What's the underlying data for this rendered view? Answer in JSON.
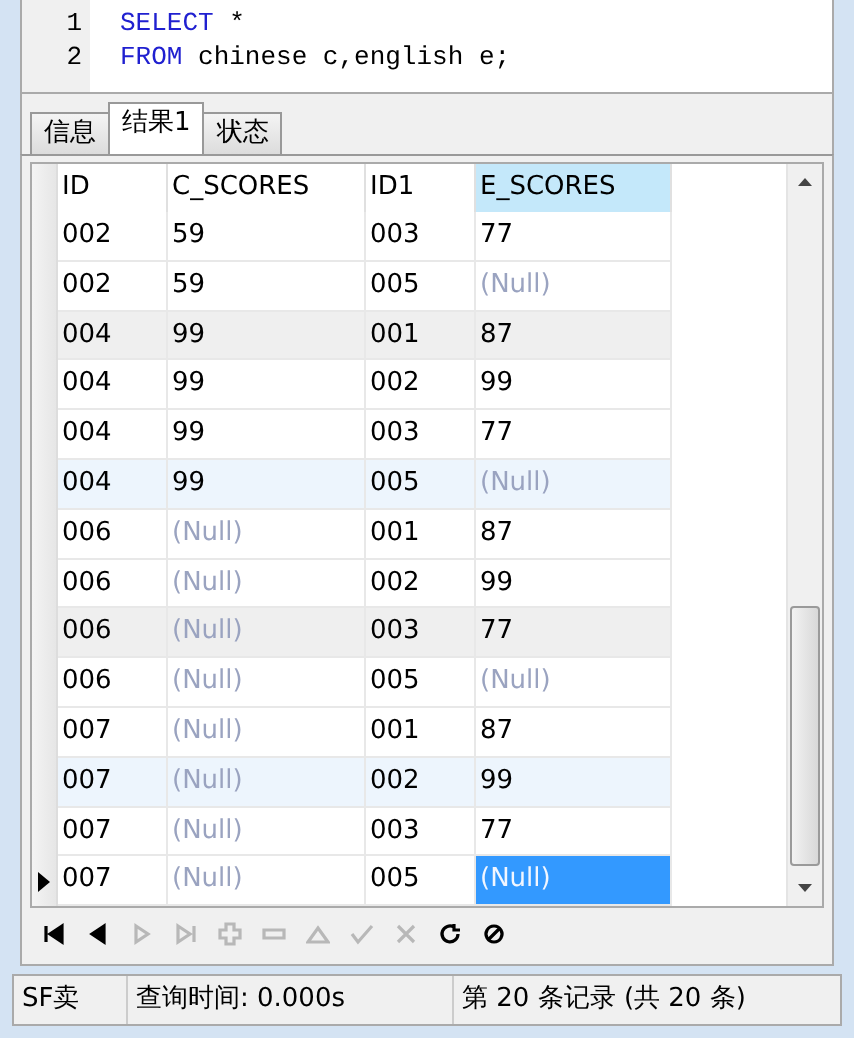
{
  "editor": {
    "lines": [
      {
        "number": "1",
        "tokens": [
          {
            "text": "SELECT",
            "kind": "keyword"
          },
          {
            "text": " *",
            "kind": "plain"
          }
        ]
      },
      {
        "number": "2",
        "tokens": [
          {
            "text": "FROM",
            "kind": "keyword"
          },
          {
            "text": " chinese c,english e;",
            "kind": "plain"
          }
        ]
      }
    ]
  },
  "tabs": [
    {
      "label": "信息",
      "selected": false
    },
    {
      "label": "结果1",
      "selected": true
    },
    {
      "label": "状态",
      "selected": false
    }
  ],
  "table": {
    "columns": [
      {
        "label": "ID",
        "selected": false
      },
      {
        "label": "C_SCORES",
        "selected": false
      },
      {
        "label": "ID1",
        "selected": false
      },
      {
        "label": "E_SCORES",
        "selected": true
      }
    ],
    "rows": [
      {
        "kind": "plain",
        "selected": false,
        "cells": [
          {
            "text": "002",
            "null": false,
            "selected": false
          },
          {
            "text": "59",
            "null": false,
            "selected": false
          },
          {
            "text": "003",
            "null": false,
            "selected": false
          },
          {
            "text": "77",
            "null": false,
            "selected": false
          }
        ]
      },
      {
        "kind": "plain",
        "selected": false,
        "cells": [
          {
            "text": "002",
            "null": false,
            "selected": false
          },
          {
            "text": "59",
            "null": false,
            "selected": false
          },
          {
            "text": "005",
            "null": false,
            "selected": false
          },
          {
            "text": "(Null)",
            "null": true,
            "selected": false
          }
        ]
      },
      {
        "kind": "shaded",
        "selected": false,
        "cells": [
          {
            "text": "004",
            "null": false,
            "selected": false
          },
          {
            "text": "99",
            "null": false,
            "selected": false
          },
          {
            "text": "001",
            "null": false,
            "selected": false
          },
          {
            "text": "87",
            "null": false,
            "selected": false
          }
        ]
      },
      {
        "kind": "plain",
        "selected": false,
        "cells": [
          {
            "text": "004",
            "null": false,
            "selected": false
          },
          {
            "text": "99",
            "null": false,
            "selected": false
          },
          {
            "text": "002",
            "null": false,
            "selected": false
          },
          {
            "text": "99",
            "null": false,
            "selected": false
          }
        ]
      },
      {
        "kind": "plain",
        "selected": false,
        "cells": [
          {
            "text": "004",
            "null": false,
            "selected": false
          },
          {
            "text": "99",
            "null": false,
            "selected": false
          },
          {
            "text": "003",
            "null": false,
            "selected": false
          },
          {
            "text": "77",
            "null": false,
            "selected": false
          }
        ]
      },
      {
        "kind": "highlighted",
        "selected": false,
        "cells": [
          {
            "text": "004",
            "null": false,
            "selected": false
          },
          {
            "text": "99",
            "null": false,
            "selected": false
          },
          {
            "text": "005",
            "null": false,
            "selected": false
          },
          {
            "text": "(Null)",
            "null": true,
            "selected": false
          }
        ]
      },
      {
        "kind": "plain",
        "selected": false,
        "cells": [
          {
            "text": "006",
            "null": false,
            "selected": false
          },
          {
            "text": "(Null)",
            "null": true,
            "selected": false
          },
          {
            "text": "001",
            "null": false,
            "selected": false
          },
          {
            "text": "87",
            "null": false,
            "selected": false
          }
        ]
      },
      {
        "kind": "plain",
        "selected": false,
        "cells": [
          {
            "text": "006",
            "null": false,
            "selected": false
          },
          {
            "text": "(Null)",
            "null": true,
            "selected": false
          },
          {
            "text": "002",
            "null": false,
            "selected": false
          },
          {
            "text": "99",
            "null": false,
            "selected": false
          }
        ]
      },
      {
        "kind": "shaded",
        "selected": false,
        "cells": [
          {
            "text": "006",
            "null": false,
            "selected": false
          },
          {
            "text": "(Null)",
            "null": true,
            "selected": false
          },
          {
            "text": "003",
            "null": false,
            "selected": false
          },
          {
            "text": "77",
            "null": false,
            "selected": false
          }
        ]
      },
      {
        "kind": "plain",
        "selected": false,
        "cells": [
          {
            "text": "006",
            "null": false,
            "selected": false
          },
          {
            "text": "(Null)",
            "null": true,
            "selected": false
          },
          {
            "text": "005",
            "null": false,
            "selected": false
          },
          {
            "text": "(Null)",
            "null": true,
            "selected": false
          }
        ]
      },
      {
        "kind": "plain",
        "selected": false,
        "cells": [
          {
            "text": "007",
            "null": false,
            "selected": false
          },
          {
            "text": "(Null)",
            "null": true,
            "selected": false
          },
          {
            "text": "001",
            "null": false,
            "selected": false
          },
          {
            "text": "87",
            "null": false,
            "selected": false
          }
        ]
      },
      {
        "kind": "highlighted",
        "selected": false,
        "cells": [
          {
            "text": "007",
            "null": false,
            "selected": false
          },
          {
            "text": "(Null)",
            "null": true,
            "selected": false
          },
          {
            "text": "002",
            "null": false,
            "selected": false
          },
          {
            "text": "99",
            "null": false,
            "selected": false
          }
        ]
      },
      {
        "kind": "plain",
        "selected": false,
        "cells": [
          {
            "text": "007",
            "null": false,
            "selected": false
          },
          {
            "text": "(Null)",
            "null": true,
            "selected": false
          },
          {
            "text": "003",
            "null": false,
            "selected": false
          },
          {
            "text": "77",
            "null": false,
            "selected": false
          }
        ]
      },
      {
        "kind": "plain",
        "selected": true,
        "cells": [
          {
            "text": "007",
            "null": false,
            "selected": false
          },
          {
            "text": "(Null)",
            "null": true,
            "selected": false
          },
          {
            "text": "005",
            "null": false,
            "selected": false
          },
          {
            "text": "(Null)",
            "null": true,
            "selected": true
          }
        ]
      }
    ]
  },
  "toolbar": [
    {
      "kind": "first",
      "disabled": false
    },
    {
      "kind": "prev",
      "disabled": false
    },
    {
      "kind": "next",
      "disabled": true
    },
    {
      "kind": "last",
      "disabled": true
    },
    {
      "kind": "add",
      "disabled": true
    },
    {
      "kind": "delete",
      "disabled": true
    },
    {
      "kind": "up",
      "disabled": true
    },
    {
      "kind": "apply",
      "disabled": true
    },
    {
      "kind": "cancel",
      "disabled": true
    },
    {
      "kind": "refresh",
      "disabled": false
    },
    {
      "kind": "stop",
      "disabled": false
    }
  ],
  "status_bar": {
    "mode": "SF卖",
    "query_time": "查询时间: 0.000s",
    "record": "第 20 条记录 (共 20 条)"
  }
}
